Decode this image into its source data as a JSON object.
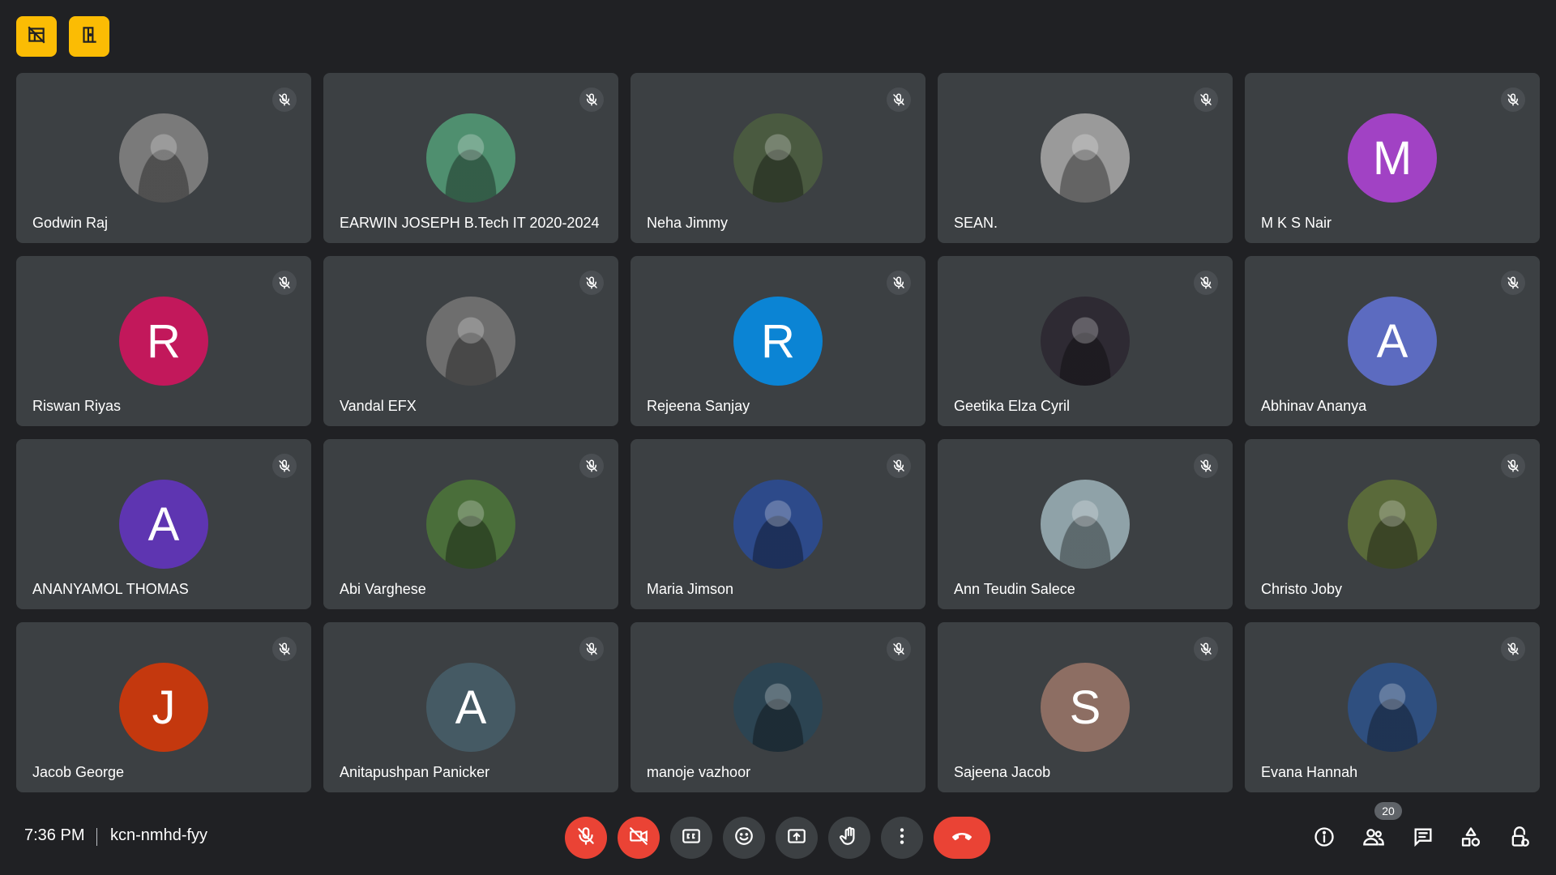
{
  "top_buttons": [
    {
      "icon": "no-layout-icon"
    },
    {
      "icon": "exit-door-icon"
    }
  ],
  "participants": [
    {
      "name": "Godwin Raj",
      "avatar_type": "photo",
      "avatar_bg": "#7a7a7a"
    },
    {
      "name": "EARWIN JOSEPH B.Tech IT 2020-2024",
      "avatar_type": "photo",
      "avatar_bg": "#4f8f6f"
    },
    {
      "name": "Neha Jimmy",
      "avatar_type": "photo",
      "avatar_bg": "#4a5a40"
    },
    {
      "name": "SEAN.",
      "avatar_type": "photo",
      "avatar_bg": "#9a9a9a"
    },
    {
      "name": "M K S Nair",
      "avatar_type": "letter",
      "letter": "M",
      "avatar_bg": "#a142c4"
    },
    {
      "name": "Riswan Riyas",
      "avatar_type": "letter",
      "letter": "R",
      "avatar_bg": "#c2185b"
    },
    {
      "name": "Vandal EFX",
      "avatar_type": "photo",
      "avatar_bg": "#6e6e6e"
    },
    {
      "name": "Rejeena Sanjay",
      "avatar_type": "letter",
      "letter": "R",
      "avatar_bg": "#0b84d4"
    },
    {
      "name": "Geetika Elza Cyril",
      "avatar_type": "photo",
      "avatar_bg": "#2e2a33"
    },
    {
      "name": "Abhinav Ananya",
      "avatar_type": "letter",
      "letter": "A",
      "avatar_bg": "#5c6bc0"
    },
    {
      "name": "ANANYAMOL THOMAS",
      "avatar_type": "letter",
      "letter": "A",
      "avatar_bg": "#5e35b1"
    },
    {
      "name": "Abi Varghese",
      "avatar_type": "photo",
      "avatar_bg": "#4a6e3a"
    },
    {
      "name": "Maria Jimson",
      "avatar_type": "photo",
      "avatar_bg": "#2d4a8a"
    },
    {
      "name": "Ann Teudin Salece",
      "avatar_type": "photo",
      "avatar_bg": "#8fa2a8"
    },
    {
      "name": "Christo Joby",
      "avatar_type": "photo",
      "avatar_bg": "#5a6a3a"
    },
    {
      "name": "Jacob George",
      "avatar_type": "letter",
      "letter": "J",
      "avatar_bg": "#c4380e"
    },
    {
      "name": "Anitapushpan Panicker",
      "avatar_type": "letter",
      "letter": "A",
      "avatar_bg": "#455a64"
    },
    {
      "name": "manoje vazhoor",
      "avatar_type": "photo",
      "avatar_bg": "#2c4452"
    },
    {
      "name": "Sajeena Jacob",
      "avatar_type": "letter",
      "letter": "S",
      "avatar_bg": "#8d6e63"
    },
    {
      "name": "Evana Hannah",
      "avatar_type": "photo",
      "avatar_bg": "#2f4f7f"
    }
  ],
  "footer": {
    "time": "7:36 PM",
    "meeting_code": "kcn-nmhd-fyy",
    "controls": [
      {
        "icon": "mic-off-icon",
        "state": "active-red"
      },
      {
        "icon": "camera-off-icon",
        "state": "active-red"
      },
      {
        "icon": "captions-icon",
        "state": "normal"
      },
      {
        "icon": "emoji-icon",
        "state": "normal"
      },
      {
        "icon": "present-screen-icon",
        "state": "normal"
      },
      {
        "icon": "raise-hand-icon",
        "state": "normal"
      },
      {
        "icon": "more-options-icon",
        "state": "normal"
      },
      {
        "icon": "hang-up-icon",
        "state": "danger"
      }
    ],
    "right_controls": [
      {
        "icon": "info-icon"
      },
      {
        "icon": "people-icon"
      },
      {
        "icon": "chat-icon"
      },
      {
        "icon": "activities-icon"
      },
      {
        "icon": "host-controls-icon"
      }
    ],
    "participant_count": "20"
  },
  "colors": {
    "background": "#202124",
    "tile": "#3c4043",
    "accent_yellow": "#fbbc04",
    "danger_red": "#ea4335"
  }
}
